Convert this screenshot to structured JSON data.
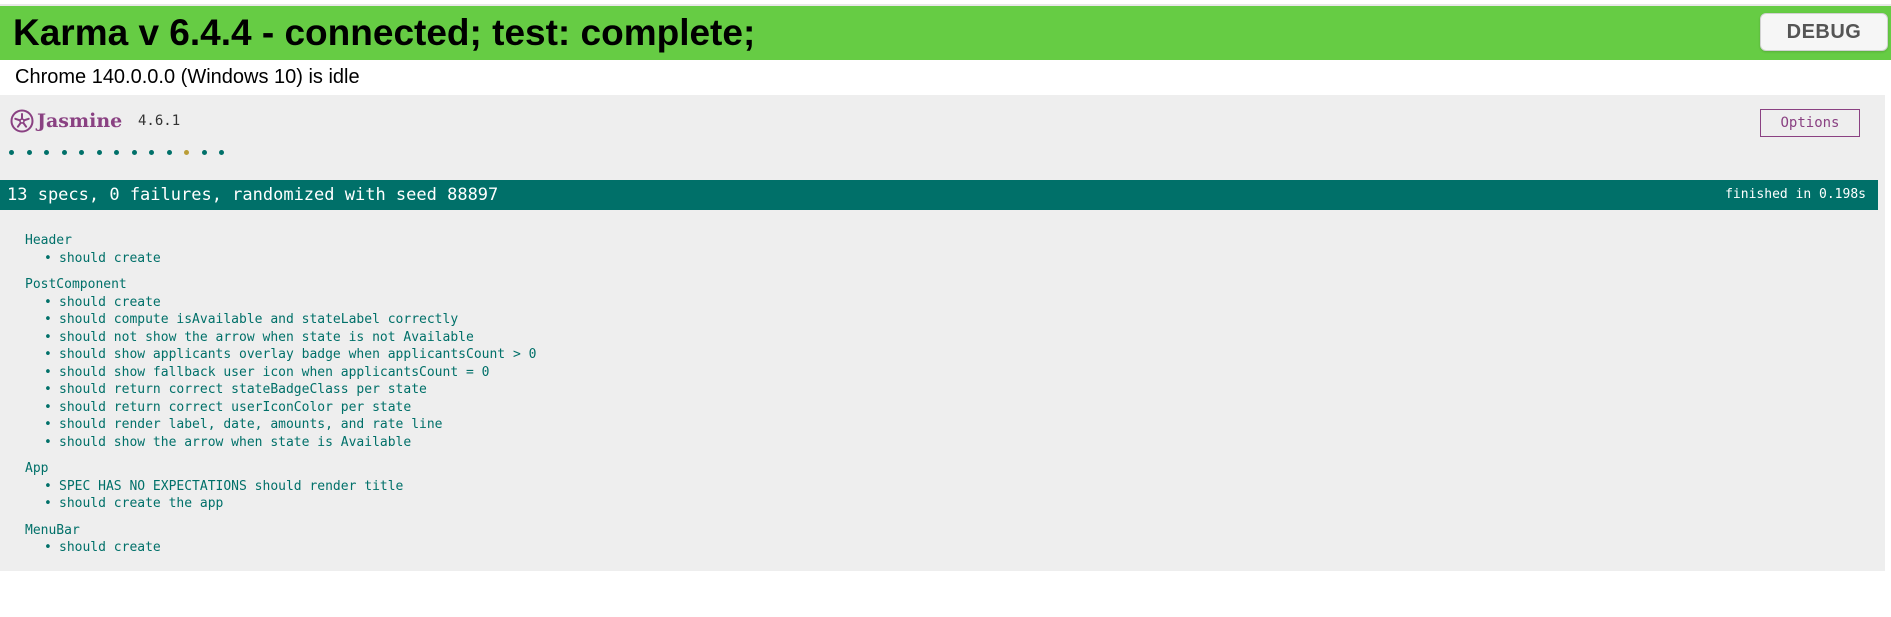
{
  "karma": {
    "title": "Karma v 6.4.4 - connected; test: complete;",
    "debug_label": "DEBUG",
    "browser_status": "Chrome 140.0.0.0 (Windows 10) is idle",
    "banner_color": "#66cc44"
  },
  "jasmine": {
    "logo_text": "Jasmine",
    "logo_icon": "jasmine-flower-icon",
    "version": "4.6.1",
    "options_label": "Options",
    "brand_color": "#8a4182",
    "accent_color": "#007069",
    "pending_color": "#ba9d37",
    "spec_dots": [
      "passed",
      "passed",
      "passed",
      "passed",
      "passed",
      "passed",
      "passed",
      "passed",
      "passed",
      "passed",
      "pending",
      "passed",
      "passed"
    ],
    "summary": "13 specs, 0 failures, randomized with seed 88897",
    "duration": "finished in 0.198s",
    "bullet": "•",
    "suites": [
      {
        "name": "Header",
        "specs": [
          "should create"
        ]
      },
      {
        "name": "PostComponent",
        "specs": [
          "should create",
          "should compute isAvailable and stateLabel correctly",
          "should not show the arrow when state is not Available",
          "should show applicants overlay badge when applicantsCount > 0",
          "should show fallback user icon when applicantsCount = 0",
          "should return correct stateBadgeClass per state",
          "should return correct userIconColor per state",
          "should render label, date, amounts, and rate line",
          "should show the arrow when state is Available"
        ]
      },
      {
        "name": "App",
        "specs": [
          "SPEC HAS NO EXPECTATIONS should render title",
          "should create the app"
        ]
      },
      {
        "name": "MenuBar",
        "specs": [
          "should create"
        ]
      }
    ]
  }
}
